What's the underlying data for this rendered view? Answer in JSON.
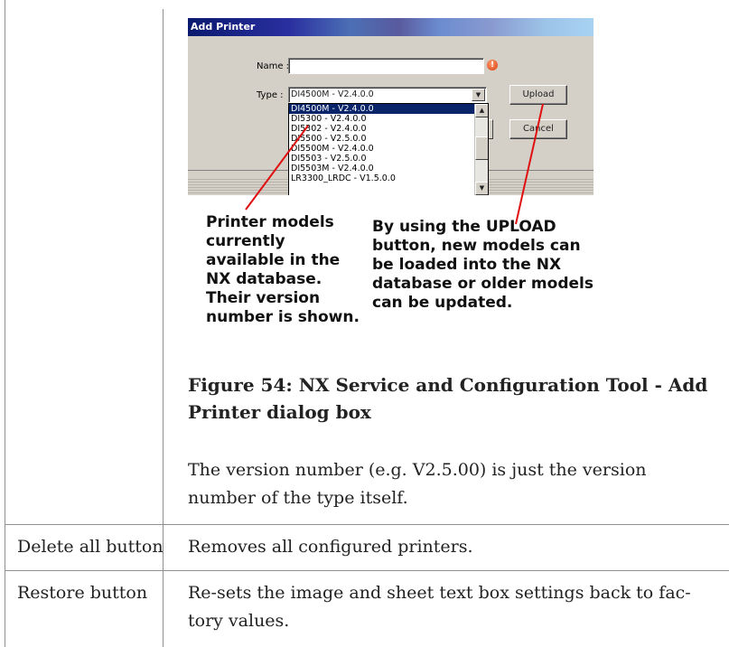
{
  "dialog": {
    "title": "Add Printer",
    "name_label": "Name :",
    "name_value": "",
    "type_label": "Type :",
    "type_value": "DI4500M - V2.4.0.0",
    "upload_label": "Upload",
    "cancel_label": "Cancel",
    "type_options": [
      "DI4500M - V2.4.0.0",
      "DI5300 - V2.4.0.0",
      "DI5302 - V2.4.0.0",
      "DI5500 - V2.5.0.0",
      "DI5500M - V2.4.0.0",
      "DI5503 - V2.5.0.0",
      "DI5503M - V2.4.0.0",
      "LR3300_LRDC - V1.5.0.0"
    ]
  },
  "annotations": {
    "left": [
      "Printer models",
      "currently",
      "available in the",
      "NX database.",
      "Their version",
      "number is shown."
    ],
    "right": [
      "By using the UPLOAD",
      "button, new models can",
      "be loaded into the NX",
      "database or older models",
      "can be updated."
    ]
  },
  "figure_caption": [
    "Figure 54: NX Service and Configuration Tool - Add",
    "Printer dialog box"
  ],
  "version_note": [
    "The version number (e.g. V2.5.00) is just the version",
    "number of the type itself."
  ],
  "rows": [
    {
      "term": "Delete all button",
      "description": [
        "Removes all configured printers."
      ]
    },
    {
      "term": "Restore button",
      "description": [
        "Re-sets the image and sheet text box settings back to fac-",
        "tory values."
      ]
    }
  ]
}
